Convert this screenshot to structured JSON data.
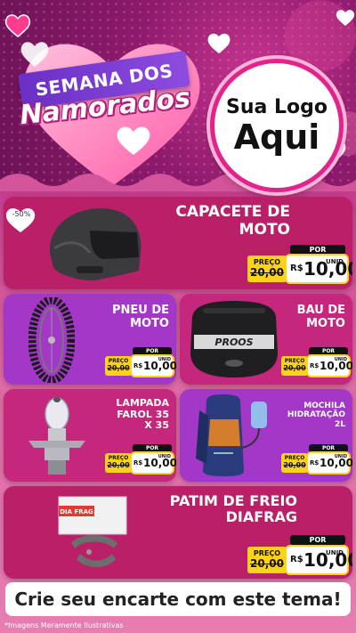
{
  "header": {
    "title_line1": "SEMANA DOS",
    "title_line2": "Namorados",
    "logo_line1": "Sua Logo",
    "logo_line2": "Aqui"
  },
  "products": [
    {
      "name_line1": "CAPACETE DE",
      "name_line2": "MOTO",
      "badge": "-50%",
      "por": "POR",
      "preco": "PREÇO",
      "old": "20,00",
      "rs": "R$",
      "price": "10,00",
      "unid": "UNID",
      "image": "helmet"
    },
    {
      "name_line1": "PNEU DE",
      "name_line2": "MOTO",
      "por": "POR",
      "preco": "PREÇO",
      "old": "20,00",
      "rs": "R$",
      "price": "10,00",
      "unid": "UNID",
      "image": "tire"
    },
    {
      "name_line1": "BAU DE",
      "name_line2": "MOTO",
      "por": "POR",
      "preco": "PREÇO",
      "old": "20,00",
      "rs": "R$",
      "price": "10,00",
      "unid": "UNID",
      "image": "top-case",
      "image_text": "PROOS"
    },
    {
      "name_line1": "LAMPADA",
      "name_line2": "FAROL 35",
      "name_line3": "X 35",
      "por": "POR",
      "preco": "PREÇO",
      "old": "20,00",
      "rs": "R$",
      "price": "10,00",
      "unid": "UNID",
      "image": "lamp"
    },
    {
      "name_line1": "MOCHILA",
      "name_line2": "HIDRATAÇÃO",
      "name_line3": "2L",
      "por": "POR",
      "preco": "PREÇO",
      "old": "20,00",
      "rs": "R$",
      "price": "10,00",
      "unid": "UNID",
      "image": "backpack"
    },
    {
      "name_line1": "PATIM DE FREIO",
      "name_line2": "DIAFRAG",
      "por": "POR",
      "preco": "PREÇO",
      "old": "20,00",
      "rs": "R$",
      "price": "10,00",
      "unid": "UNID",
      "image": "brake-pads",
      "image_text": "DIA FRAG"
    }
  ],
  "footer": {
    "cta": "Crie seu encarte com este tema!",
    "note": "*Imagens Meramente Ilustrativas"
  },
  "colors": {
    "accent_pink": "#c4277b",
    "accent_purple": "#a338c8",
    "price_yellow": "#ffd21a"
  }
}
